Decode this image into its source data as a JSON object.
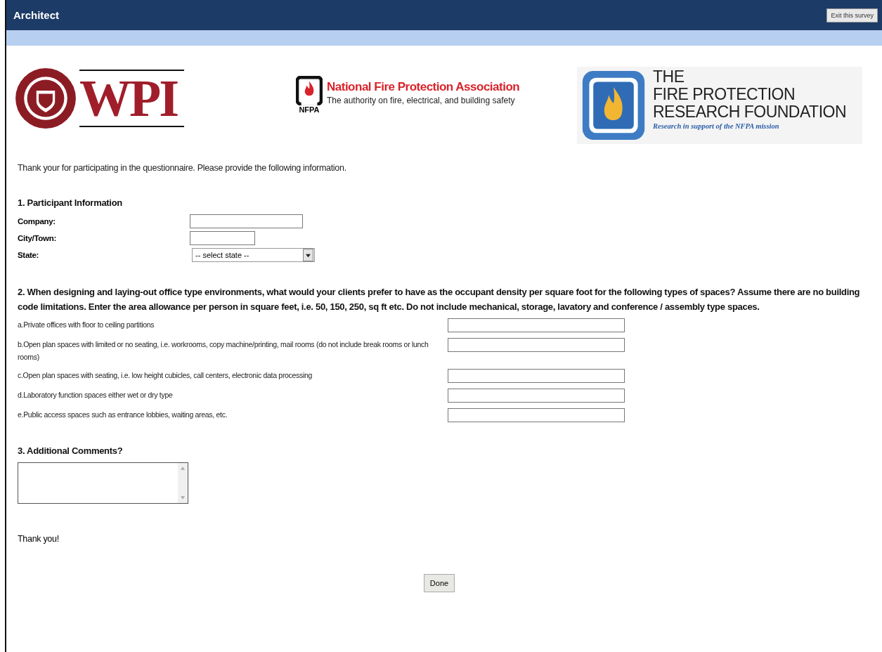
{
  "header": {
    "title": "Architect",
    "exit_button": "Exit this survey"
  },
  "logos": {
    "wpi": {
      "text": "WPI"
    },
    "nfpa": {
      "badge": "NFPA",
      "name": "National Fire Protection Association",
      "tagline": "The authority on fire, electrical, and building safety"
    },
    "foundation": {
      "lines": [
        "THE",
        "FIRE PROTECTION",
        "RESEARCH FOUNDATION"
      ],
      "tagline": "Research in support of the NFPA mission"
    }
  },
  "intro": "Thank your for participating in the questionnaire. Please provide the following information.",
  "sections": [
    {
      "kind": "fields",
      "title": "1. Participant Information",
      "fields": [
        {
          "label": "Company:",
          "kind": "text"
        },
        {
          "label": "City/Town:",
          "kind": "short_text"
        },
        {
          "label": "State:",
          "kind": "select",
          "value": "-- select state --"
        }
      ]
    },
    {
      "kind": "grid",
      "title": "2. When designing and laying-out office type environments, what would your clients prefer to have as the occupant density per square foot for the following types of spaces? Assume there are no building code limitations. Enter the area allowance per person in square feet, i.e. 50, 150, 250, sq ft etc. Do not include mechanical, storage, lavatory and conference / assembly type spaces.",
      "rows": [
        {
          "label": "a.Private offices with floor to ceiling partitions"
        },
        {
          "label": "b.Open plan spaces with limited or no seating, i.e. workrooms, copy machine/printing, mail rooms (do not include break rooms or lunch rooms)"
        },
        {
          "label": "c.Open plan spaces with seating, i.e. low height cubicles, call centers, electronic data processing"
        },
        {
          "label": "d.Laboratory function spaces either wet or dry type"
        },
        {
          "label": "e.Public access spaces such as entrance lobbies, waiting areas, etc."
        }
      ]
    },
    {
      "kind": "comment",
      "title": "3. Additional Comments?"
    }
  ],
  "closing": "Thank you!",
  "done_button": "Done"
}
